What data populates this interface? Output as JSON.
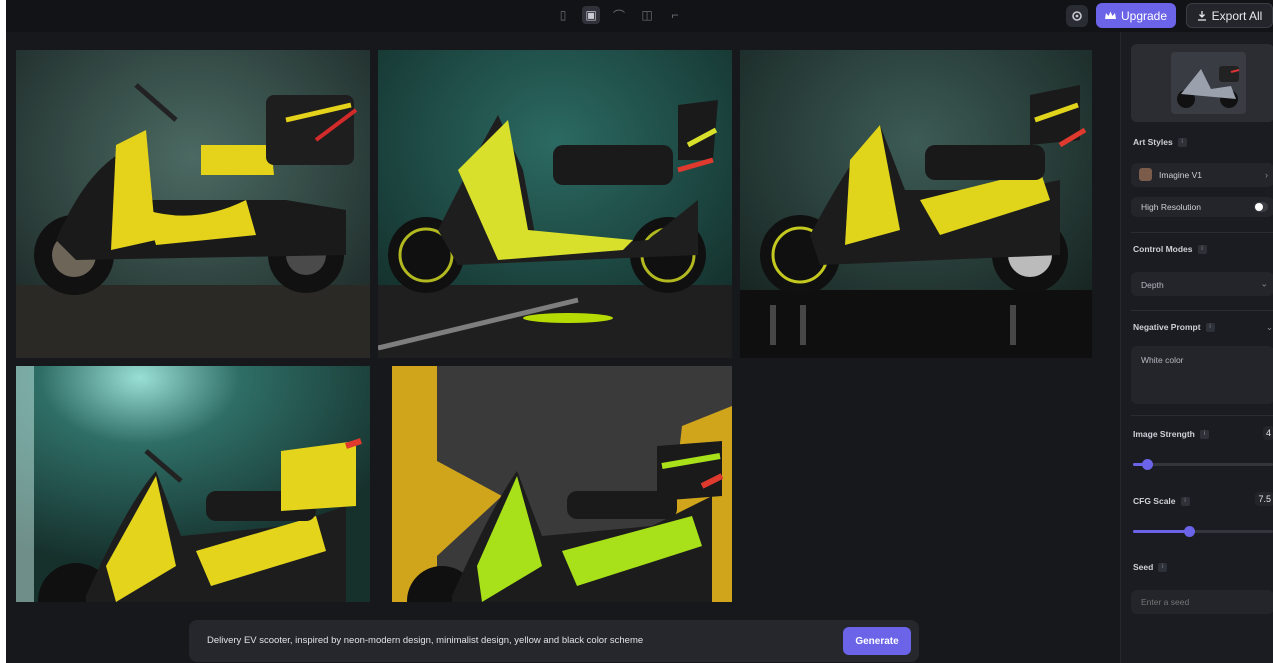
{
  "topbar": {
    "tools": [
      "frame-icon",
      "image-icon",
      "brush-icon",
      "layers-icon",
      "crop-icon"
    ],
    "upgrade_label": "Upgrade",
    "export_label": "Export All"
  },
  "gallery": {
    "images": [
      {
        "alt": "scooter-1"
      },
      {
        "alt": "scooter-2"
      },
      {
        "alt": "scooter-3"
      },
      {
        "alt": "scooter-4"
      },
      {
        "alt": "scooter-5"
      }
    ]
  },
  "prompt": {
    "text": "Delivery EV scooter, inspired by neon-modern design, minimalist design, yellow and black color scheme",
    "generate_label": "Generate"
  },
  "sidebar": {
    "art_styles_label": "Art Styles",
    "style_value": "Imagine V1",
    "high_res_label": "High Resolution",
    "control_modes_label": "Control Modes",
    "control_mode_value": "Depth",
    "negative_prompt_label": "Negative Prompt",
    "negative_prompt_value": "White color",
    "image_strength_label": "Image Strength",
    "image_strength_value": "4",
    "image_strength_level": 0.1,
    "cfg_scale_label": "CFG Scale",
    "cfg_scale_value": "7.5",
    "cfg_scale_level": 0.4,
    "seed_label": "Seed",
    "seed_placeholder": "Enter a seed"
  },
  "colors": {
    "accent": "#6b63e8",
    "background": "#17181c",
    "panel": "#1b1c21"
  }
}
